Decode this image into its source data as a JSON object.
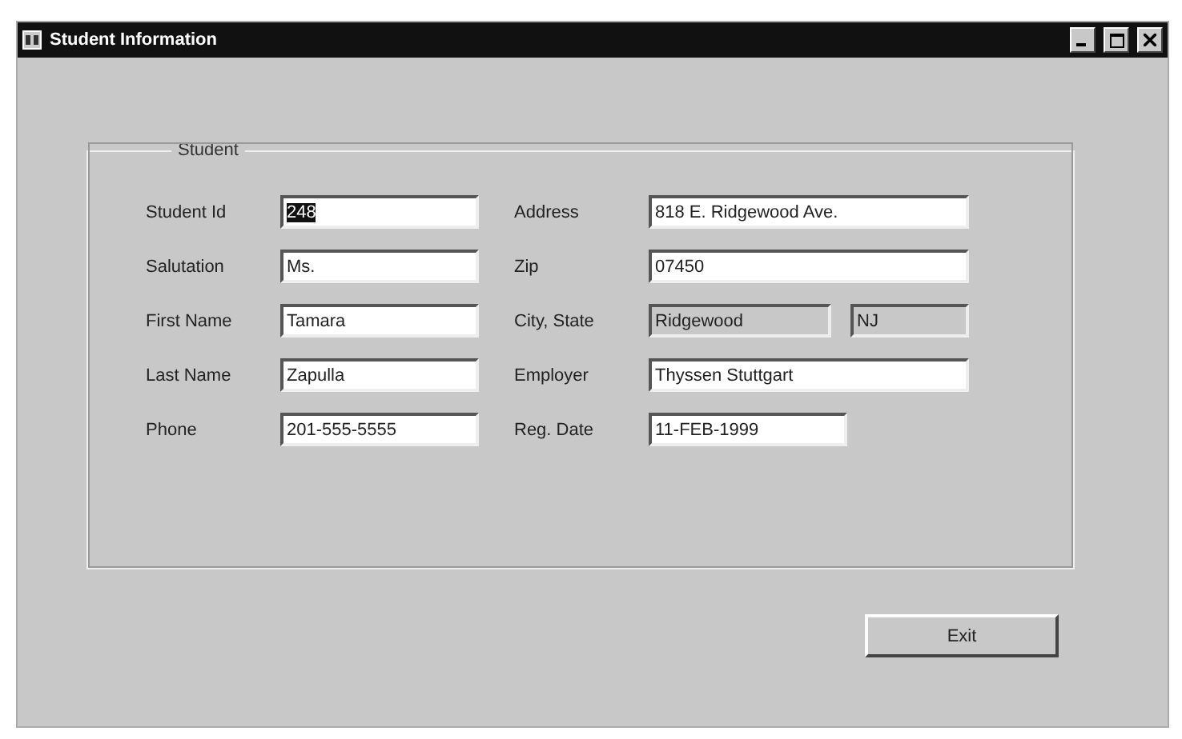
{
  "window": {
    "title": "Student Information"
  },
  "group": {
    "title": "Student"
  },
  "left_fields": [
    {
      "label": "Student Id",
      "inputs": [
        {
          "value": "248",
          "disabled": false,
          "selected": true
        }
      ]
    },
    {
      "label": "Salutation",
      "inputs": [
        {
          "value": "Ms.",
          "disabled": false,
          "selected": false
        }
      ]
    },
    {
      "label": "First Name",
      "inputs": [
        {
          "value": "Tamara",
          "disabled": false,
          "selected": false
        }
      ]
    },
    {
      "label": "Last Name",
      "inputs": [
        {
          "value": "Zapulla",
          "disabled": false,
          "selected": false
        }
      ]
    },
    {
      "label": "Phone",
      "inputs": [
        {
          "value": "201-555-5555",
          "disabled": false,
          "selected": false
        }
      ]
    }
  ],
  "right_fields": [
    {
      "label": "Address",
      "inputs": [
        {
          "value": "818 E. Ridgewood Ave.",
          "disabled": false,
          "selected": false
        }
      ]
    },
    {
      "label": "Zip",
      "inputs": [
        {
          "value": "07450",
          "disabled": false,
          "selected": false
        }
      ]
    },
    {
      "label": "City, State",
      "inputs": [
        {
          "value": "Ridgewood",
          "disabled": true,
          "selected": false
        },
        {
          "value": "NJ",
          "disabled": true,
          "selected": false
        }
      ]
    },
    {
      "label": "Employer",
      "inputs": [
        {
          "value": "Thyssen Stuttgart",
          "disabled": false,
          "selected": false
        }
      ]
    },
    {
      "label": "Reg. Date",
      "inputs": [
        {
          "value": "11-FEB-1999",
          "disabled": false,
          "selected": false,
          "short": true
        }
      ]
    }
  ],
  "buttons": [
    "Exit"
  ]
}
